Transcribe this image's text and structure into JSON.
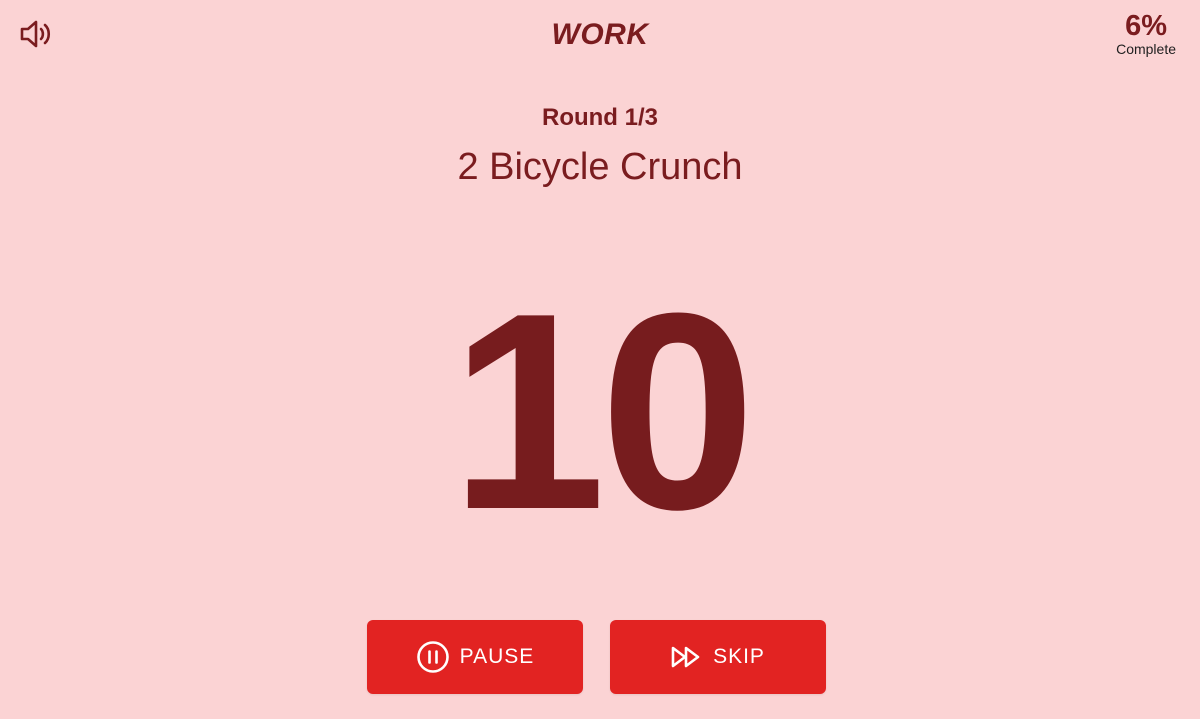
{
  "header": {
    "sound_icon": "speaker-volume-icon",
    "phase": "WORK",
    "progress_percent": "6%",
    "progress_label": "Complete"
  },
  "workout": {
    "round": "Round 1/3",
    "exercise": "2 Bicycle Crunch",
    "countdown": "10"
  },
  "controls": {
    "pause_label": "PAUSE",
    "pause_icon": "pause-circle-icon",
    "skip_label": "SKIP",
    "skip_icon": "fast-forward-icon"
  },
  "colors": {
    "background": "#fbd3d4",
    "text_dark_red": "#7a1c1f",
    "button_red": "#e22322",
    "button_text": "#ffffff"
  }
}
